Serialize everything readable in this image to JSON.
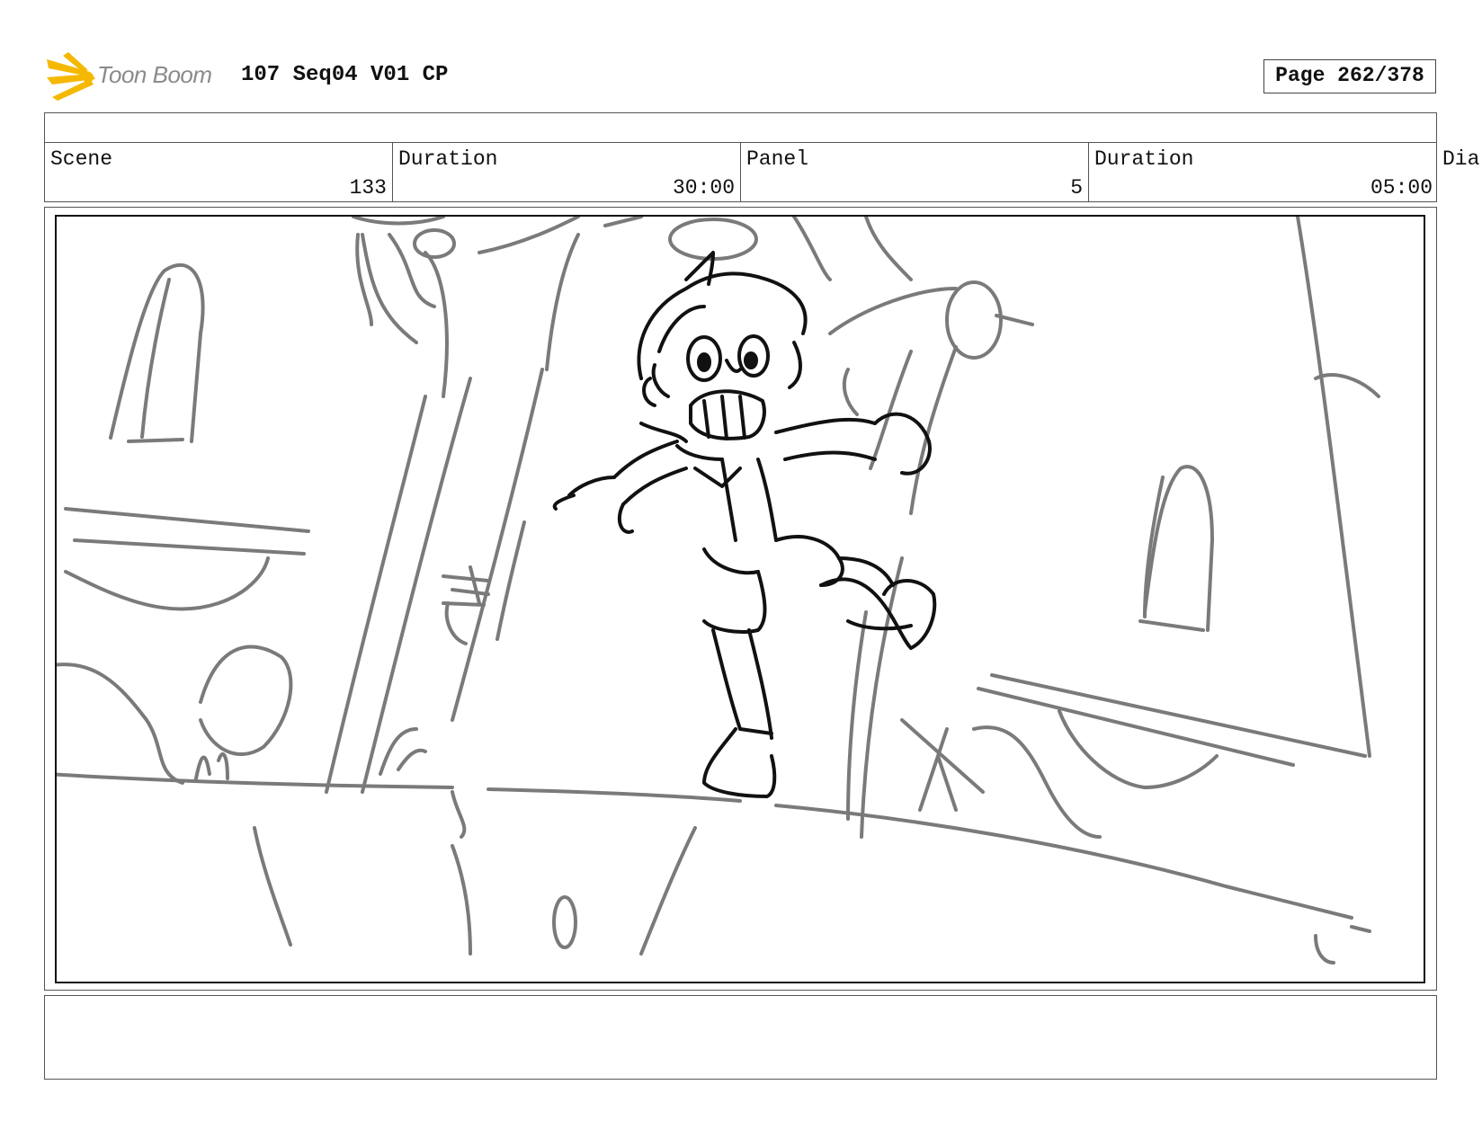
{
  "header": {
    "logo_text": "Toon Boom",
    "title": "107 Seq04 V01 CP",
    "page": "Page 262/378"
  },
  "info": {
    "scene_label": "Scene",
    "scene_value": "133",
    "scene_duration_label": "Duration",
    "scene_duration_value": "30:00",
    "panel_label": "Panel",
    "panel_value": "5",
    "panel_duration_label": "Duration",
    "panel_duration_value": "05:00",
    "dialogue_label": "Dia"
  },
  "notes": {
    "text": ""
  },
  "colors": {
    "logo_yellow": "#f5b800",
    "sketch_gray": "#7a7a7a",
    "sketch_black": "#111111"
  }
}
